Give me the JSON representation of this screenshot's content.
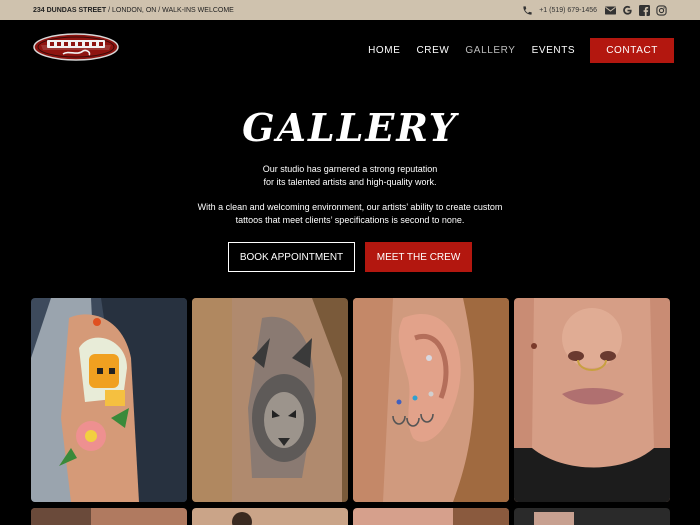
{
  "topbar": {
    "address_bold": "234 DUNDAS STREET",
    "address_rest": " / LONDON, ON / WALK-INS WELCOME",
    "phone": "+1 (519) 679-1456",
    "icons": [
      "phone-icon",
      "mail-icon",
      "google-icon",
      "facebook-icon",
      "instagram-icon"
    ]
  },
  "logo": {
    "line1": "ADDICTIVE",
    "line2": "Tattoo"
  },
  "nav": {
    "items": [
      "HOME",
      "CREW",
      "GALLERY",
      "EVENTS"
    ],
    "active": "GALLERY",
    "contact": "CONTACT"
  },
  "hero": {
    "title": "GALLERY",
    "p1_line1": "Our studio has garnered a strong reputation",
    "p1_line2": "for its talented artists and high-quality work.",
    "p2_line1": "With a clean and welcoming environment, our artists’ ability to create custom",
    "p2_line2": "tattoos that meet clients’ specifications is second to none.",
    "book_label": "BOOK APPOINTMENT",
    "crew_label": "MEET THE CREW"
  },
  "colors": {
    "accent": "#b3170f",
    "topbar": "#cfc2ae",
    "background": "#000000"
  },
  "gallery": {
    "items": [
      "skull-tattoo-photo",
      "lion-tattoo-photo",
      "ear-piercing-photo",
      "septum-piercing-photo"
    ]
  }
}
